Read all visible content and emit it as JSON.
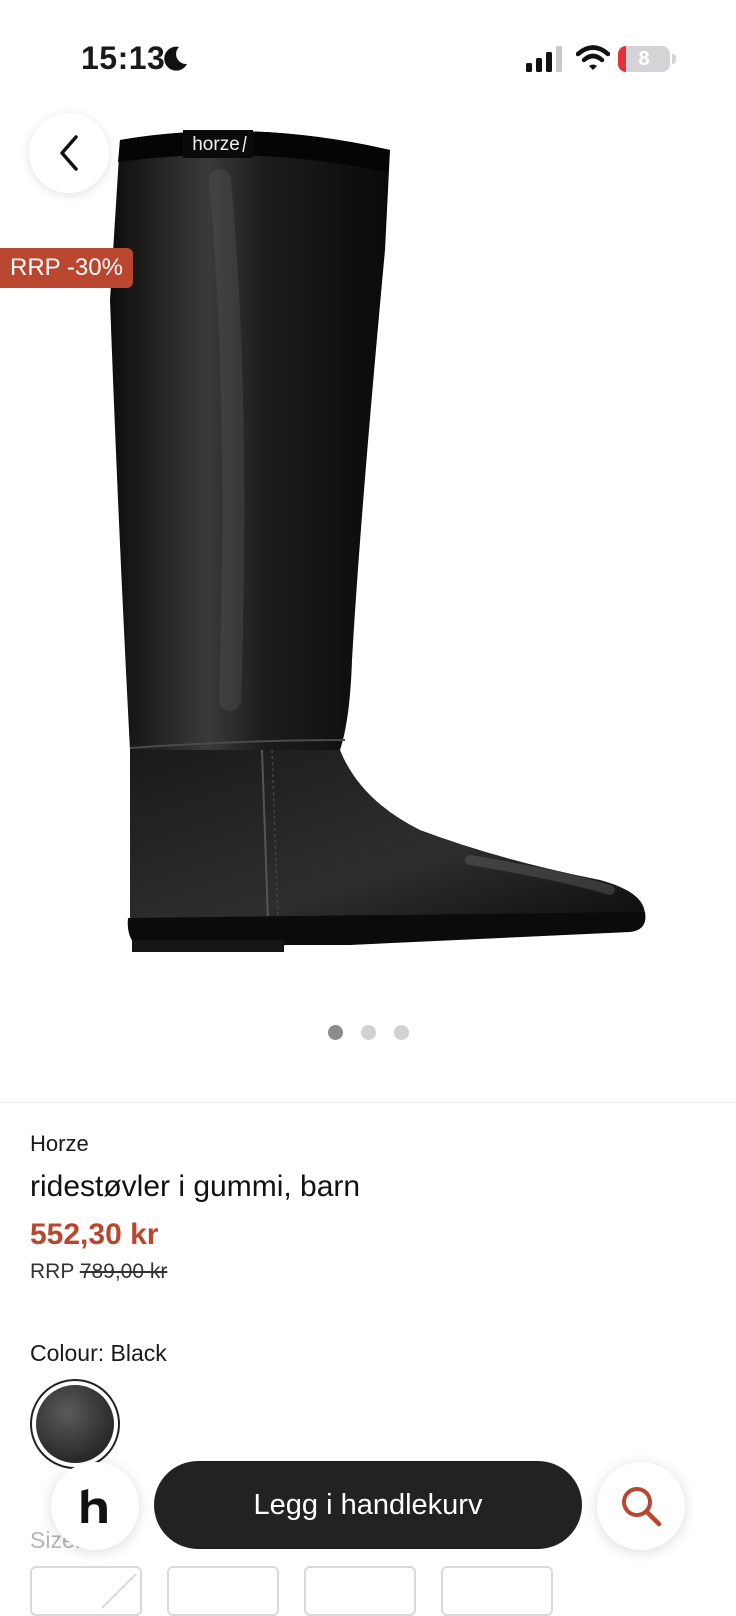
{
  "status_bar": {
    "time": "15:13",
    "battery_percent": "8",
    "icons": [
      "moon-icon",
      "signal-icon",
      "wifi-icon",
      "battery-icon"
    ]
  },
  "gallery": {
    "logo_text": "horze",
    "badge": "RRP -30%",
    "image_count": 3,
    "active_index": 0
  },
  "product": {
    "brand": "Horze",
    "title": "ridestøvler i gummi, barn",
    "price": "552,30 kr",
    "rrp_label": "RRP",
    "rrp_price": "789,00 kr",
    "colour_label": "Colour: Black",
    "size_label": "Size:"
  },
  "actions": {
    "home_icon": "h-logo-icon",
    "cart_label": "Legg i handlekurv",
    "search_icon": "search-icon"
  },
  "colors": {
    "accent": "#b9462f",
    "button_dark": "#222222"
  }
}
